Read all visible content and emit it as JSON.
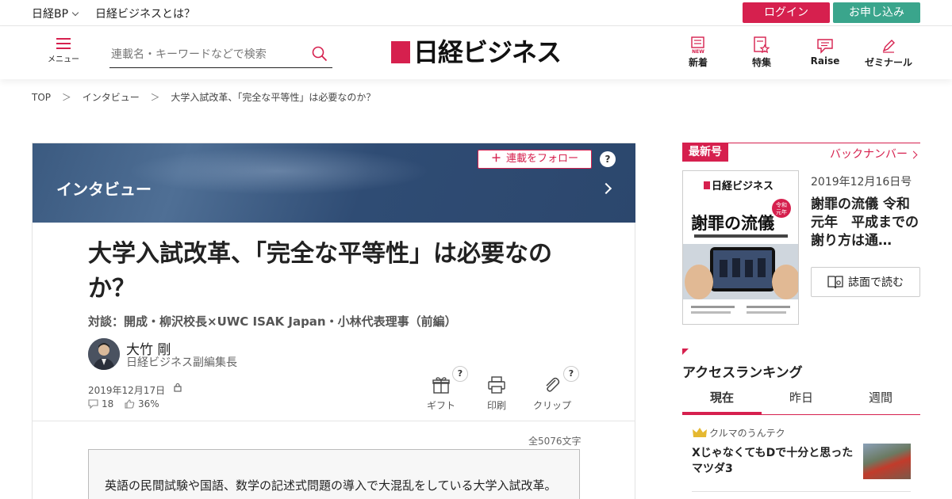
{
  "topbar": {
    "brand": "日経BP",
    "about": "日経ビジネスとは？",
    "login": "ログイン",
    "apply": "お申し込み"
  },
  "header": {
    "menu_label": "メニュー",
    "search_placeholder": "連載名・キーワードなどで検索",
    "logo_text": "日経ビジネス",
    "nav": [
      {
        "label": "新着",
        "icon": "new-icon"
      },
      {
        "label": "特集",
        "icon": "feature-icon"
      },
      {
        "label": "Raise",
        "icon": "raise-icon"
      },
      {
        "label": "ゼミナール",
        "icon": "seminar-icon"
      }
    ]
  },
  "breadcrumb": [
    "TOP",
    "インタビュー",
    "大学入試改革、「完全な平等性」は必要なのか？"
  ],
  "breadcrumb_sep": "＞",
  "article": {
    "series": "インタビュー",
    "follow_label": "連載をフォロー",
    "help": "?",
    "title": "大学入試改革、「完全な平等性」は必要なのか？",
    "subtitle": "対談：開成・柳沢校長×UWC ISAK Japan・小林代表理事（前編）",
    "author": "大竹 剛",
    "author_role": "日経ビジネス副編集長",
    "date": "2019年12月17日",
    "comments": "18",
    "likes": "36%",
    "tools": {
      "gift": "ギフト",
      "print": "印刷",
      "clip": "クリップ"
    },
    "char_count": "全5076文字",
    "lead": "英語の民間試験や国語、数学の記述式問題の導入で大混乱をしている大学入試改革。日本の競争力を高めるために大学入試改革の必要性を"
  },
  "sidebar": {
    "latest_label": "最新号",
    "back_numbers": "バックナンバー",
    "issue_date": "2019年12月16日号",
    "issue_title": "謝罪の流儀 令和元年　平成までの謝り方は通…",
    "read_label": "誌面で読む",
    "cover": {
      "logo": "日経ビジネス",
      "headline": "謝罪の流儀",
      "tag": "令和元年"
    },
    "ranking_title": "アクセスランキング",
    "ranking_tabs": [
      "現在",
      "昨日",
      "週間"
    ],
    "ranking_items": [
      {
        "category": "クルマのうんテク",
        "title": "XじゃなくてもDで十分と思ったマツダ3"
      }
    ]
  },
  "colors": {
    "accent": "#d6204e",
    "apply": "#3aa58c",
    "banner": "#3b5a80"
  }
}
